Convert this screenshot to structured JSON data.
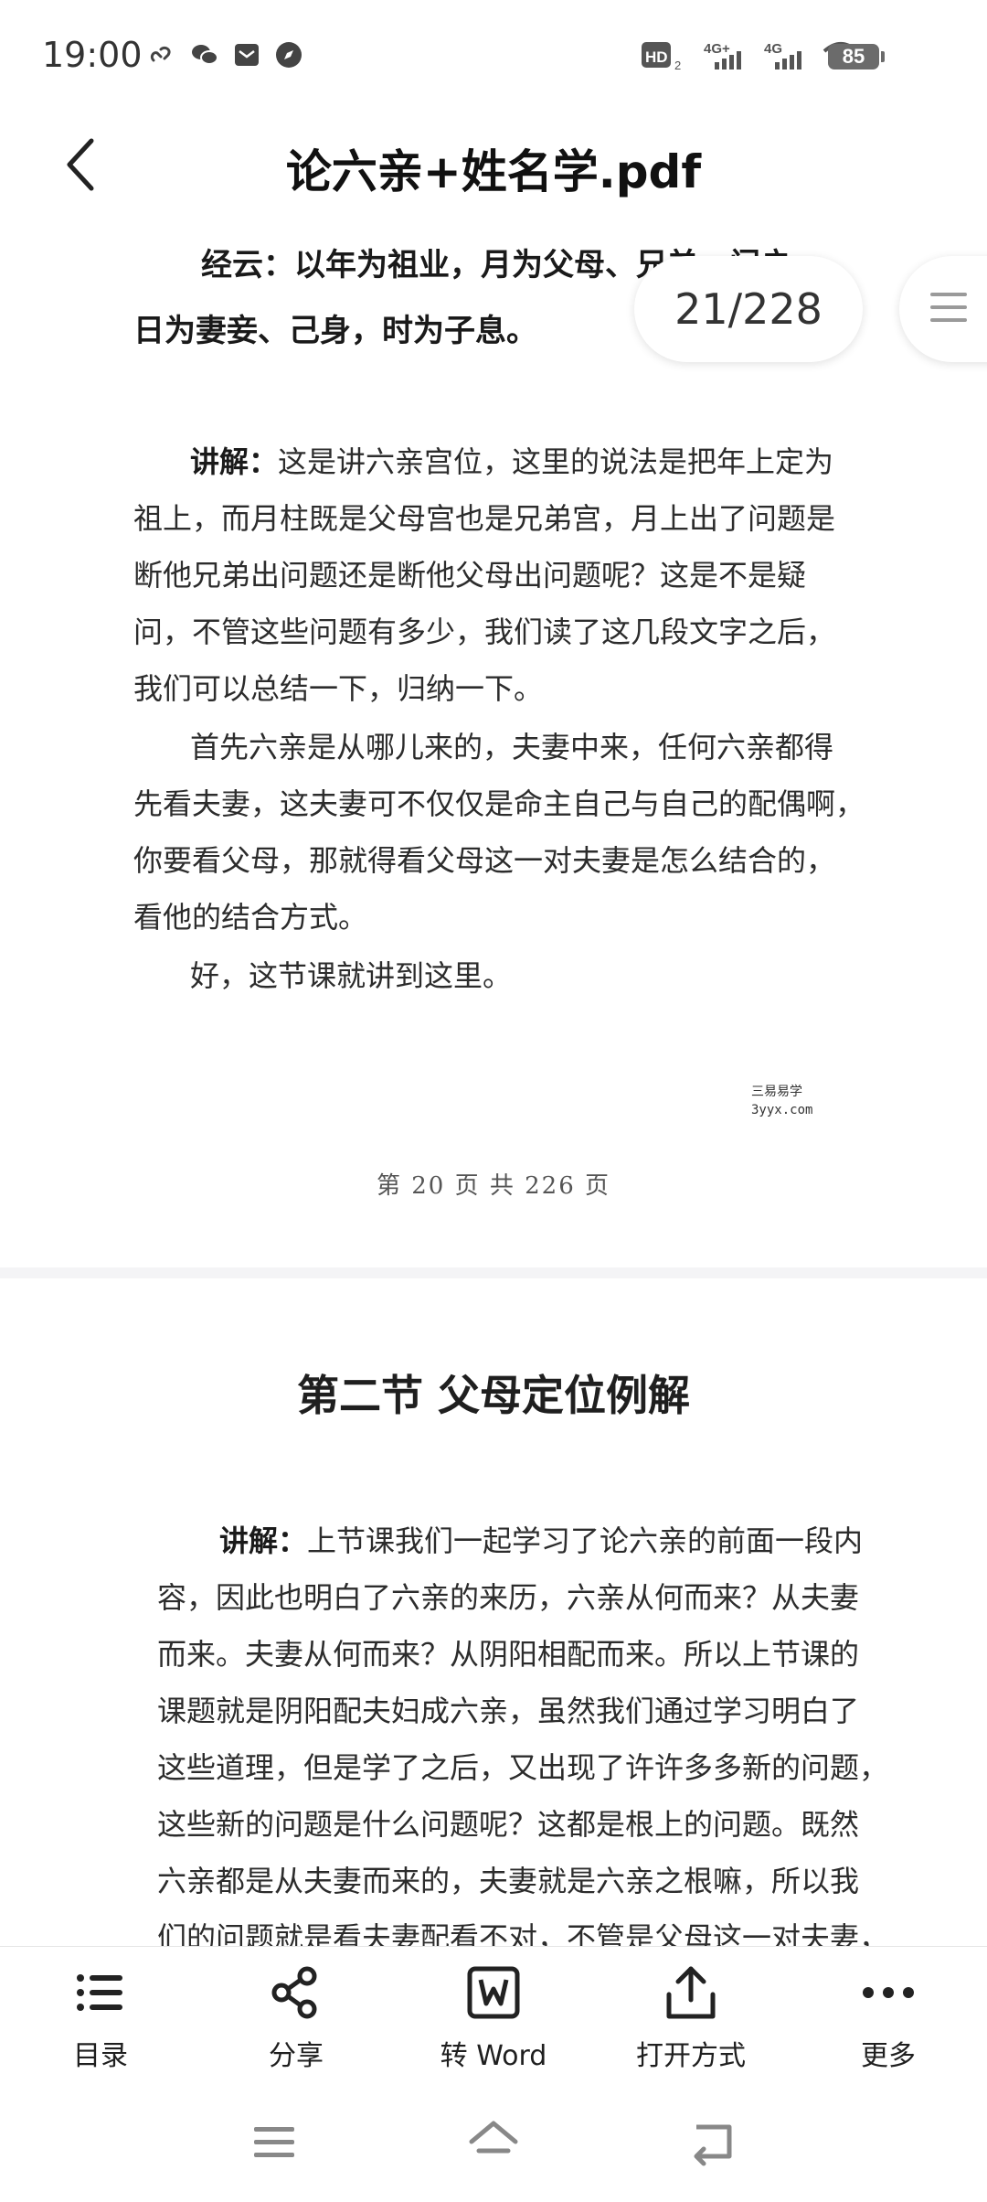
{
  "status_bar": {
    "time": "19:00",
    "left_icons": [
      "link-icon",
      "wechat-icon",
      "message-icon",
      "compass-icon"
    ],
    "right_icons": [
      "hd-icon",
      "signal-4g-plus-icon",
      "signal-4g-icon",
      "wifi-icon"
    ],
    "hd_label": "HD",
    "sim1_label": "4G+",
    "sim2_label": "4G",
    "battery": "85"
  },
  "header": {
    "title": "论六亲+姓名学.pdf"
  },
  "viewer": {
    "page_counter": "21/228",
    "page_a": {
      "heading_line1": "经云：以年为祖业，月为父母、兄弟，门户，",
      "heading_line2": "日为妻妾、己身，时为子息。",
      "para1_label": "讲解：",
      "para1_lines": [
        "这是讲六亲宫位，这里的说法是把年上定为",
        "祖上，而月柱既是父母宫也是兄弟宫，月上出了问题是",
        "断他兄弟出问题还是断他父母出问题呢？这是不是疑",
        "问，不管这些问题有多少，我们读了这几段文字之后，",
        "我们可以总结一下，归纳一下。"
      ],
      "para2_lines": [
        "首先六亲是从哪儿来的，夫妻中来，任何六亲都得",
        "先看夫妻，这夫妻可不仅仅是命主自己与自己的配偶啊，",
        "你要看父母，那就得看父母这一对夫妻是怎么结合的，",
        "看他的结合方式。"
      ],
      "para3": "好，这节课就讲到这里。",
      "watermark_line1": "三易易学",
      "watermark_line2": "3yyx.com",
      "footer": "第 20 页 共 226 页"
    },
    "page_b": {
      "section_title": "第二节  父母定位例解",
      "para_label": "讲解：",
      "lines": [
        "上节课我们一起学习了论六亲的前面一段内",
        "容，因此也明白了六亲的来历，六亲从何而来？从夫妻",
        "而来。夫妻从何而来？从阴阳相配而来。所以上节课的",
        "课题就是阴阳配夫妇成六亲，虽然我们通过学习明白了",
        "这些道理，但是学了之后，又出现了许许多多新的问题，",
        "这些新的问题是什么问题呢？这都是根上的问题。既然",
        "六亲都是从夫妻而来的，夫妻就是六亲之根嘛，所以我",
        "们的问题就是看夫妻配看不对，不管是父母这一对夫妻，"
      ]
    }
  },
  "toolbar": {
    "items": [
      {
        "label": "目录",
        "icon": "list-icon"
      },
      {
        "label": "分享",
        "icon": "share-icon"
      },
      {
        "label": "转 Word",
        "icon": "word-convert-icon"
      },
      {
        "label": "打开方式",
        "icon": "open-with-icon"
      },
      {
        "label": "更多",
        "icon": "more-icon"
      }
    ]
  },
  "navbar": {
    "icons": [
      "menu-icon",
      "home-icon",
      "back-icon"
    ]
  }
}
